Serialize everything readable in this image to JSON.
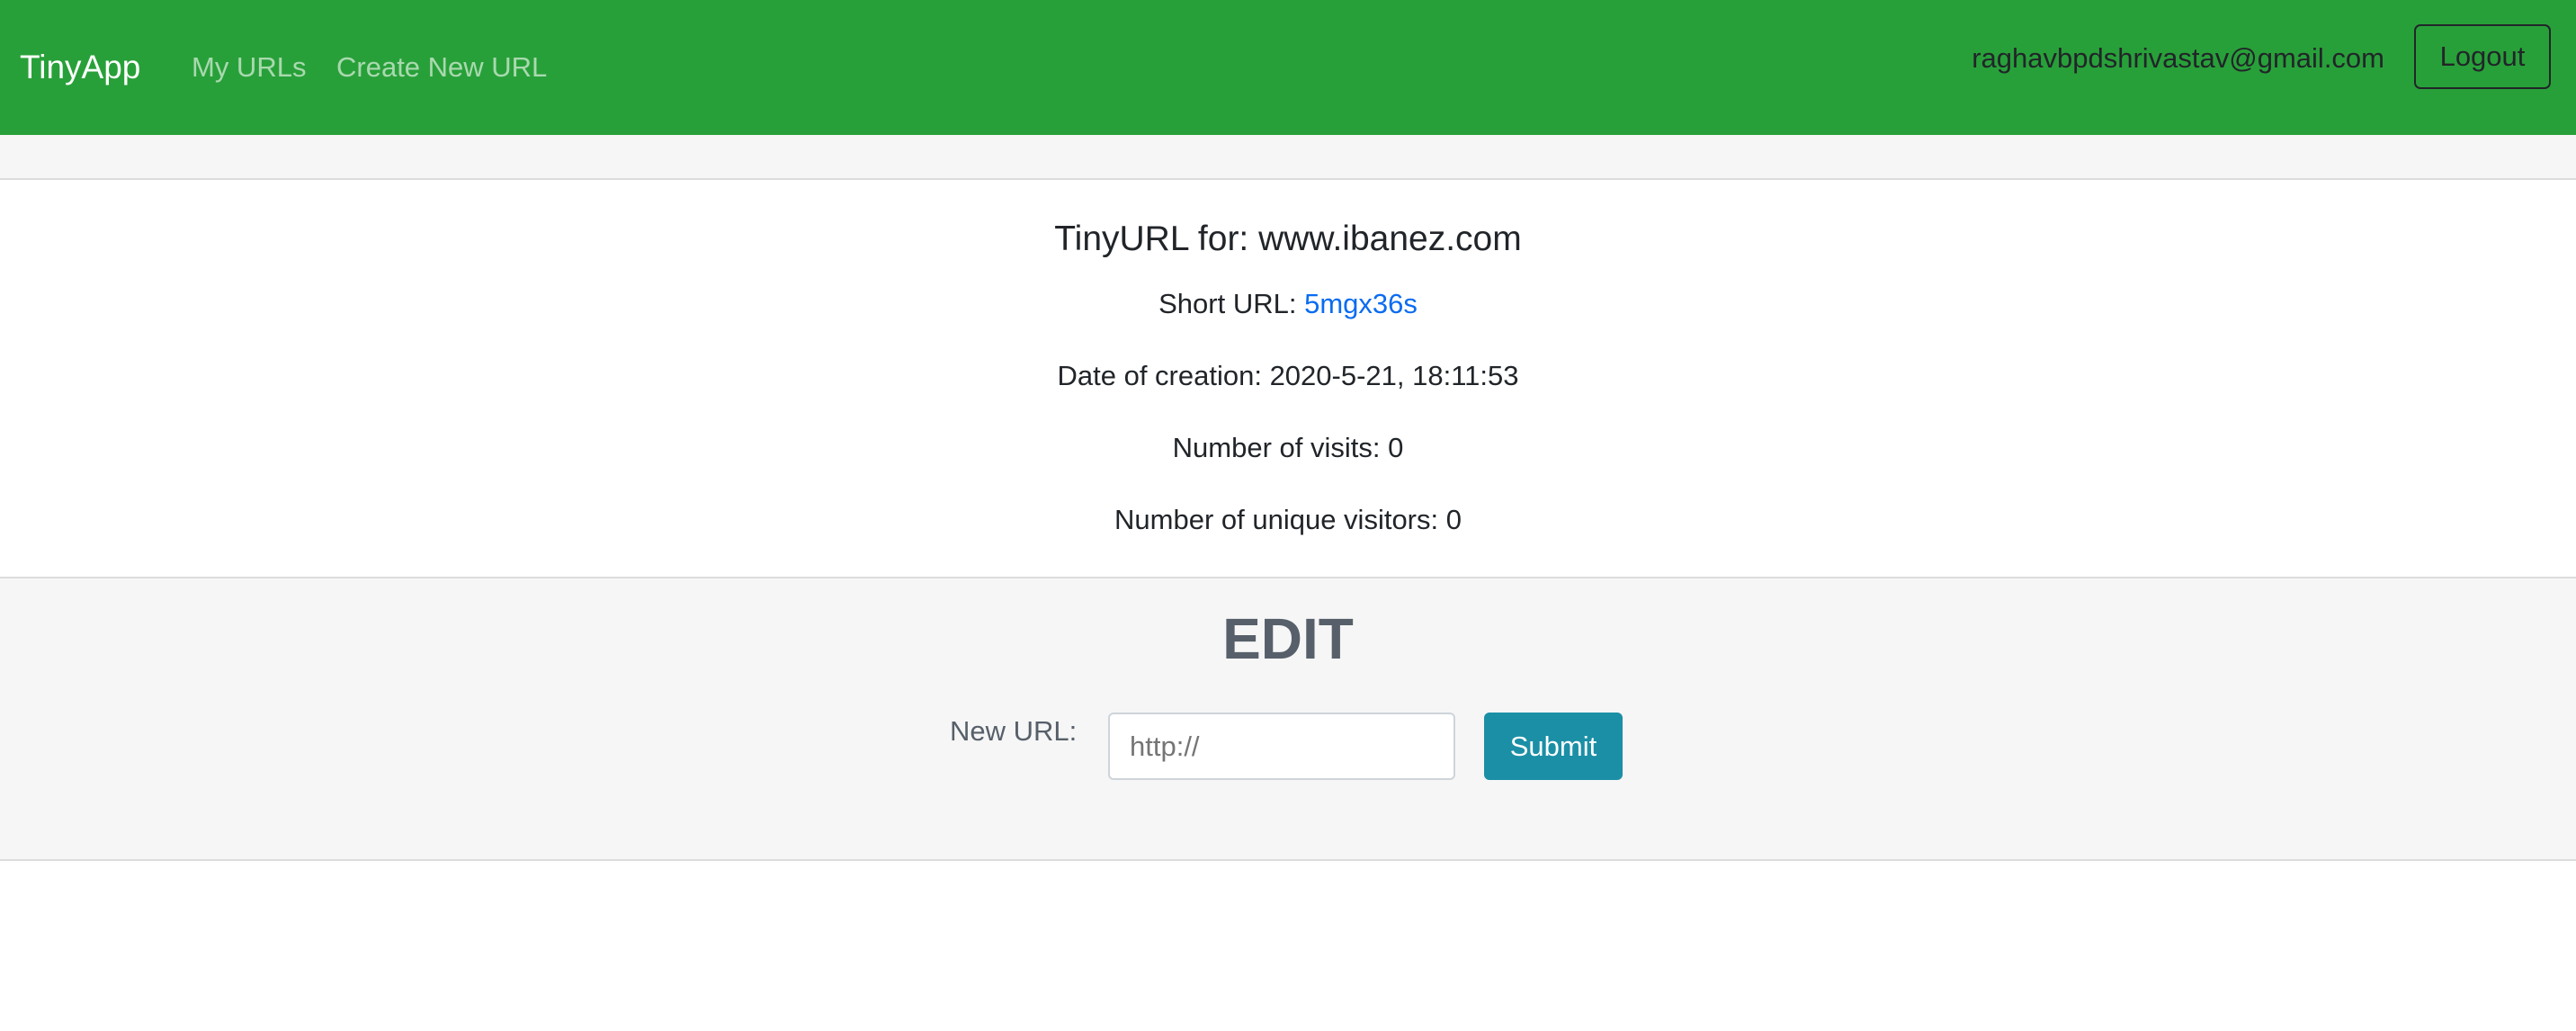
{
  "navbar": {
    "brand": "TinyApp",
    "links": [
      "My URLs",
      "Create New URL"
    ],
    "user_email": "raghavbpdshrivastav@gmail.com",
    "logout_label": "Logout",
    "background_color": "#28a039"
  },
  "url_info": {
    "title": "TinyURL for: www.ibanez.com",
    "short_url_label": "Short URL: ",
    "short_url_value": "5mgx36s",
    "date_label": "Date of creation: ",
    "date_value": "2020-5-21, 18:11:53",
    "visits_label": "Number of visits: ",
    "visits_value": "0",
    "unique_label": "Number of unique visitors: ",
    "unique_value": "0"
  },
  "edit": {
    "title": "EDIT",
    "new_url_label": "New URL:",
    "input_placeholder": "http://",
    "input_value": "",
    "submit_label": "Submit",
    "submit_color": "#1b8fa6"
  }
}
